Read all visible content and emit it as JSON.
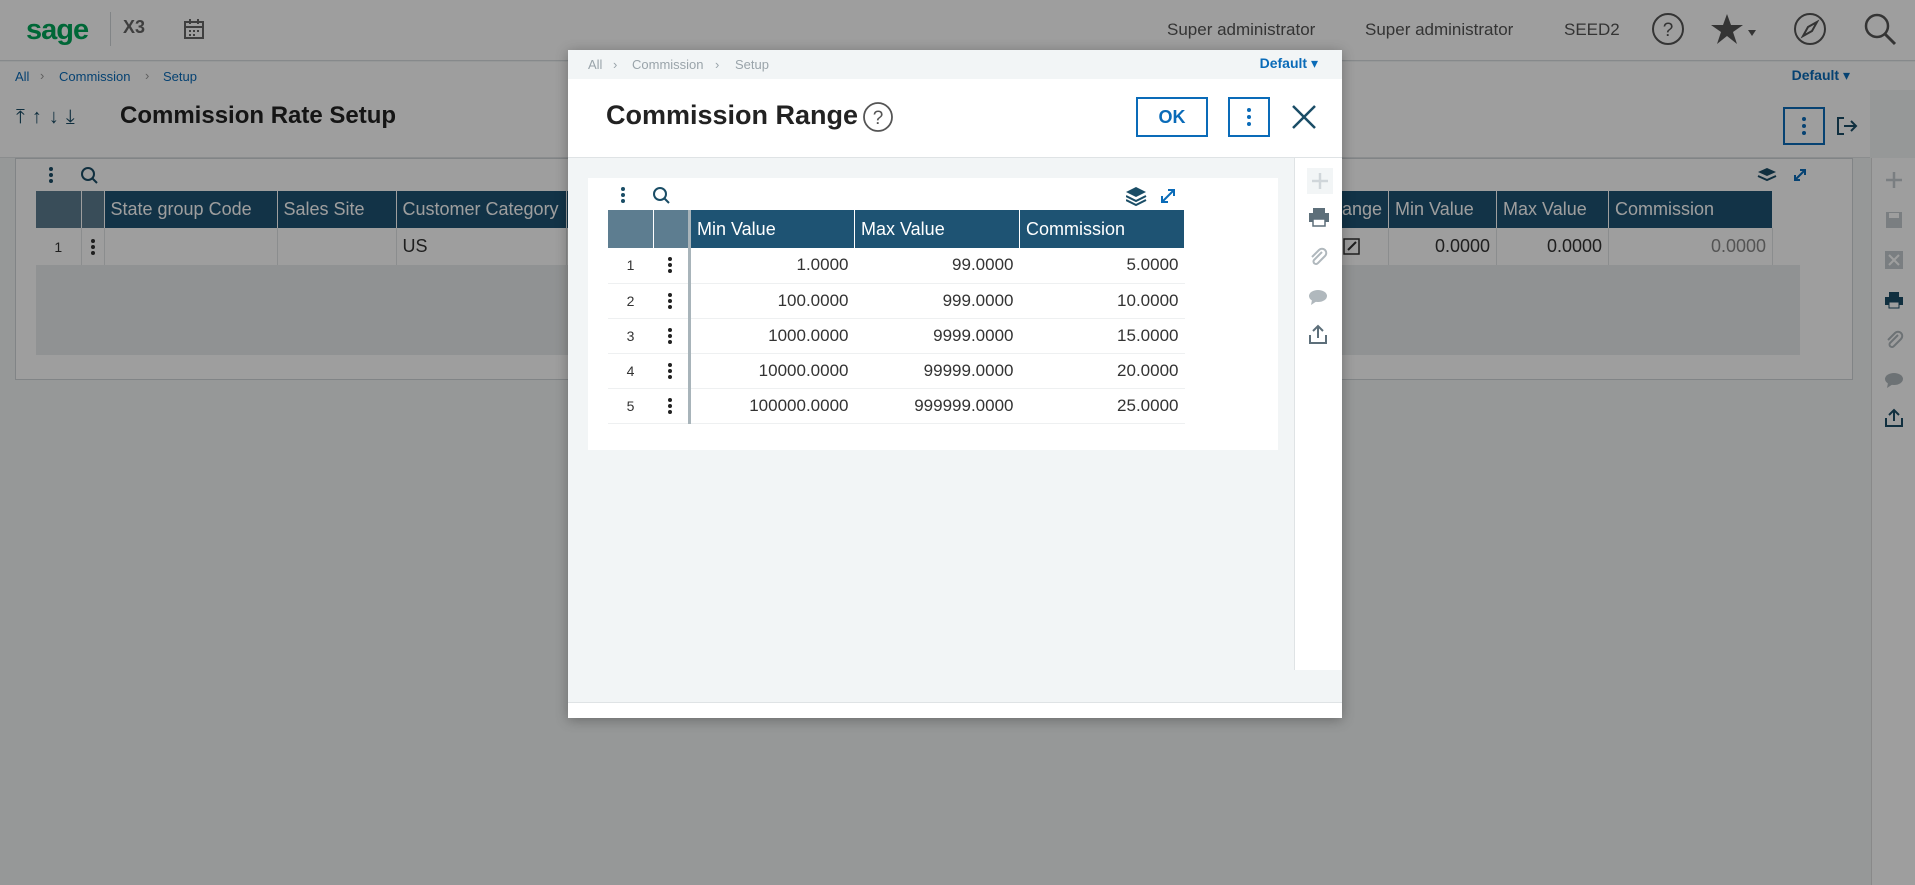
{
  "app": {
    "logo": "sage",
    "product": "X3",
    "user_1": "Super administrator",
    "user_2": "Super administrator",
    "folder": "SEED2"
  },
  "breadcrumb": {
    "items": [
      "All",
      "Commission",
      "Setup"
    ],
    "view": "Default"
  },
  "page": {
    "title": "Commission Rate Setup"
  },
  "bg_grid": {
    "columns": [
      "State group Code",
      "Sales Site",
      "Customer Category"
    ],
    "right_columns": [
      "ange",
      "Min Value",
      "Max Value",
      "Commission"
    ],
    "row": {
      "num": "1",
      "customer_category": "US",
      "min": "0.0000",
      "max": "0.0000",
      "commission": "0.0000"
    }
  },
  "modal": {
    "breadcrumb": [
      "All",
      "Commission",
      "Setup"
    ],
    "view": "Default",
    "title": "Commission Range",
    "ok_label": "OK",
    "table": {
      "columns": [
        "Min Value",
        "Max Value",
        "Commission"
      ],
      "rows": [
        {
          "num": "1",
          "min": "1.0000",
          "max": "99.0000",
          "commission": "5.0000"
        },
        {
          "num": "2",
          "min": "100.0000",
          "max": "999.0000",
          "commission": "10.0000"
        },
        {
          "num": "3",
          "min": "1000.0000",
          "max": "9999.0000",
          "commission": "15.0000"
        },
        {
          "num": "4",
          "min": "10000.0000",
          "max": "99999.0000",
          "commission": "20.0000"
        },
        {
          "num": "5",
          "min": "100000.0000",
          "max": "999999.0000",
          "commission": "25.0000"
        }
      ]
    }
  },
  "colors": {
    "accent": "#0a6bb8",
    "header": "#1e5373",
    "brand": "#00a65a"
  }
}
